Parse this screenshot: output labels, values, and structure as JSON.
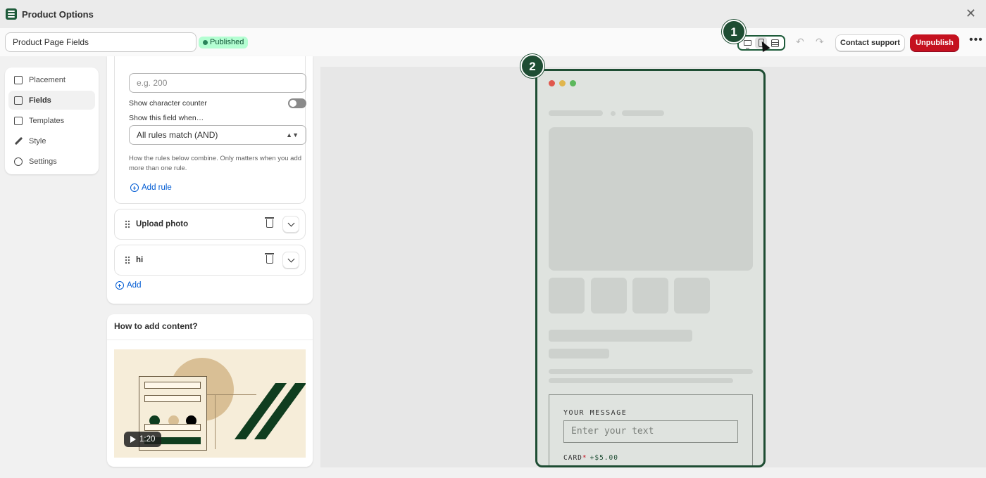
{
  "app": {
    "title": "Product Options"
  },
  "header": {
    "name_value": "Product Page Fields",
    "status_badge": "Published",
    "contact_support": "Contact support",
    "unpublish": "Unpublish",
    "more": "•••",
    "view_modes": [
      "desktop-icon",
      "mobile-icon",
      "fullscreen-icon"
    ],
    "active_view_mode": "mobile-icon"
  },
  "steps": {
    "one": "1",
    "two": "2"
  },
  "sidebar": {
    "items": [
      {
        "label": "Placement",
        "icon": "page-icon"
      },
      {
        "label": "Fields",
        "icon": "edit-icon",
        "active": true
      },
      {
        "label": "Templates",
        "icon": "template-icon"
      },
      {
        "label": "Style",
        "icon": "brush-icon"
      },
      {
        "label": "Settings",
        "icon": "gear-icon"
      }
    ]
  },
  "rules": {
    "max_chars_placeholder": "e.g. 200",
    "show_counter_label": "Show character counter",
    "show_counter_enabled": false,
    "show_when_label": "Show this field when…",
    "match_select_value": "All rules match (AND)",
    "help_text": "How the rules below combine. Only matters when you add more than one rule.",
    "add_rule": "Add rule"
  },
  "fields": [
    {
      "name": "Upload photo"
    },
    {
      "name": "hi"
    }
  ],
  "add_field": "Add",
  "howto": {
    "title": "How to add content?",
    "video_duration": "1:20"
  },
  "preview": {
    "message_label": "YOUR MESSAGE",
    "message_placeholder": "Enter your text",
    "card_label": "CARD",
    "card_required_mark": "*",
    "card_price": "+$5.00"
  },
  "colors": {
    "brand": "#1e4d33",
    "unpublish": "#c5111f",
    "published_badge": "#b4fed2",
    "link": "#005bd3"
  }
}
